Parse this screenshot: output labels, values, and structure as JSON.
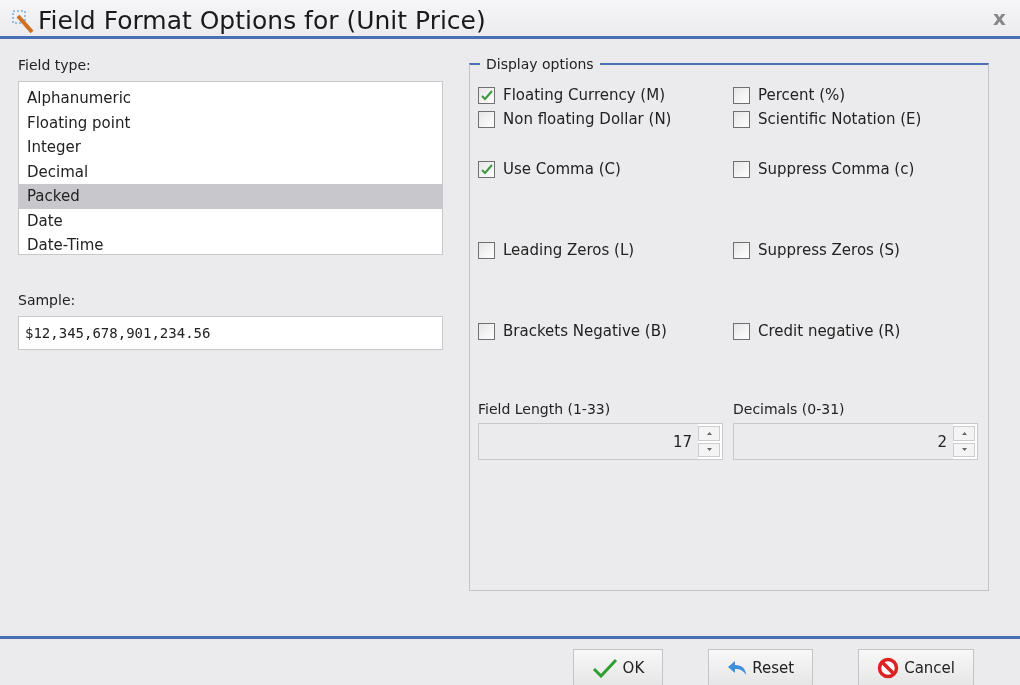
{
  "window": {
    "title": "Field Format Options for (Unit Price)",
    "close": "x"
  },
  "field_type": {
    "label": "Field type:",
    "items": [
      {
        "label": "Alphanumeric",
        "selected": false
      },
      {
        "label": "Floating point",
        "selected": false
      },
      {
        "label": "Integer",
        "selected": false
      },
      {
        "label": "Decimal",
        "selected": false
      },
      {
        "label": "Packed",
        "selected": true
      },
      {
        "label": "Date",
        "selected": false
      },
      {
        "label": "Date-Time",
        "selected": false
      }
    ]
  },
  "sample": {
    "label": "Sample:",
    "value": "$12,345,678,901,234.56"
  },
  "display_options": {
    "title": "Display options",
    "rows": [
      [
        {
          "label": "Floating Currency (M)",
          "checked": true
        },
        {
          "label": "Percent (%)",
          "checked": false
        }
      ],
      [
        {
          "label": "Non floating Dollar (N)",
          "checked": false
        },
        {
          "label": "Scientific Notation (E)",
          "checked": false
        }
      ],
      [
        {
          "label": "Use Comma (C)",
          "checked": true
        },
        {
          "label": "Suppress Comma (c)",
          "checked": false
        }
      ],
      [
        {
          "label": "Leading Zeros (L)",
          "checked": false
        },
        {
          "label": "Suppress Zeros (S)",
          "checked": false
        }
      ],
      [
        {
          "label": "Brackets Negative (B)",
          "checked": false
        },
        {
          "label": "Credit negative (R)",
          "checked": false
        }
      ]
    ],
    "spinners": [
      {
        "label": "Field Length (1-33)",
        "value": "17"
      },
      {
        "label": "Decimals (0-31)",
        "value": "2"
      }
    ]
  },
  "buttons": [
    {
      "kind": "ok",
      "label": "OK"
    },
    {
      "kind": "reset",
      "label": "Reset"
    },
    {
      "kind": "cancel",
      "label": "Cancel"
    }
  ]
}
